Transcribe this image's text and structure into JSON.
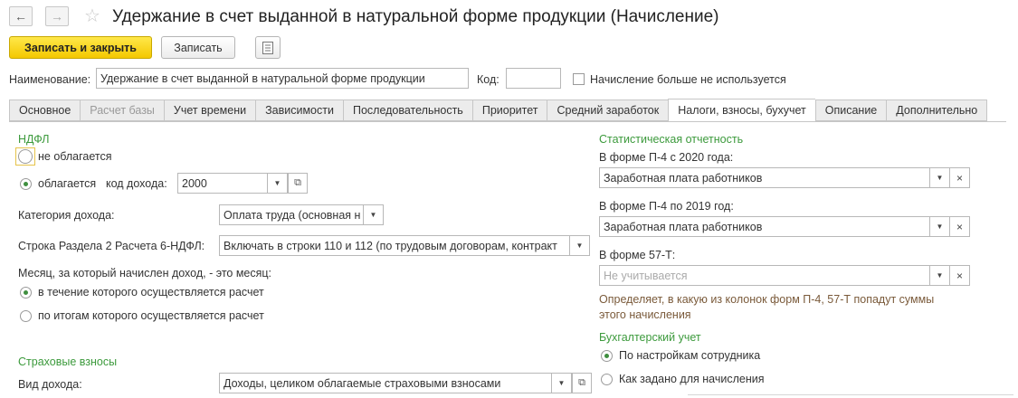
{
  "window": {
    "title": "Удержание в счет выданной в натуральной форме продукции (Начисление)",
    "back_icon": "arrow-left",
    "forward_icon": "arrow-right",
    "favorite_icon": "star"
  },
  "toolbar": {
    "save_close": "Записать и закрыть",
    "save": "Записать",
    "menu_icon": "document-list"
  },
  "header": {
    "name_label": "Наименование:",
    "name_value": "Удержание в счет выданной в натуральной форме продукции",
    "code_label": "Код:",
    "code_value": "",
    "unused_label": "Начисление больше не используется"
  },
  "tabs": [
    {
      "label": "Основное",
      "state": "normal"
    },
    {
      "label": "Расчет базы",
      "state": "disabled"
    },
    {
      "label": "Учет времени",
      "state": "normal"
    },
    {
      "label": "Зависимости",
      "state": "normal"
    },
    {
      "label": "Последовательность",
      "state": "normal"
    },
    {
      "label": "Приоритет",
      "state": "normal"
    },
    {
      "label": "Средний заработок",
      "state": "normal"
    },
    {
      "label": "Налоги, взносы, бухучет",
      "state": "active"
    },
    {
      "label": "Описание",
      "state": "normal"
    },
    {
      "label": "Дополнительно",
      "state": "normal"
    }
  ],
  "ndfl": {
    "title": "НДФЛ",
    "not_taxed": "не облагается",
    "taxed": "облагается",
    "income_code_label": "код дохода:",
    "income_code_value": "2000",
    "category_label": "Категория дохода:",
    "category_value": "Оплата труда (основная н",
    "row_label": "Строка Раздела 2 Расчета 6-НДФЛ:",
    "row_value": "Включать в строки 110 и 112 (по трудовым договорам, контракт",
    "month_label": "Месяц, за который начислен доход, - это месяц:",
    "month_option1": "в течение которого осуществляется расчет",
    "month_option2": "по итогам которого осуществляется расчет"
  },
  "insurance": {
    "title": "Страховые взносы",
    "income_type_label": "Вид дохода:",
    "income_type_value": "Доходы, целиком облагаемые страховыми взносами"
  },
  "stats": {
    "title": "Статистическая отчетность",
    "p4_2020_label": "В форме П-4 с 2020 года:",
    "p4_2020_value": "Заработная плата работников",
    "p4_2019_label": "В форме П-4 по 2019 год:",
    "p4_2019_value": "Заработная плата работников",
    "f57_label": "В форме 57-Т:",
    "f57_placeholder": "Не учитывается",
    "hint_line1": "Определяет, в какую из колонок форм П-4, 57-Т попадут суммы",
    "hint_line2": "этого начисления"
  },
  "accounting": {
    "title": "Бухгалтерский учет",
    "option1": "По настройкам сотрудника",
    "option2": "Как задано для начисления"
  }
}
